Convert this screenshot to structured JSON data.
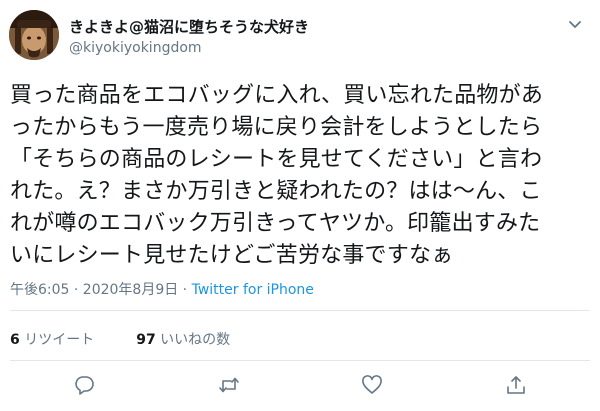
{
  "user": {
    "display_name": "きよきよ@猫沼に堕ちそうな犬好き",
    "handle": "@kiyokiyokingdom"
  },
  "tweet": {
    "lines": [
      "買った商品をエコバッグに入れ、買い忘れた品物があ",
      "ったからもう一度売り場に戻り会計をしようとしたら",
      "「そちらの商品のレシートを見せてください」と言わ",
      "れた。え？まさか万引きと疑われたの？はは〜ん、こ",
      "れが噂のエコバック万引きってヤツか。印籠出すみた",
      "いにレシート見せたけどご苦労な事ですなぁ"
    ],
    "timestamp": "午後6:05 · 2020年8月9日 · ",
    "source": "Twitter for iPhone"
  },
  "stats": {
    "retweets_count": "6",
    "retweets_label": "リツイート",
    "likes_count": "97",
    "likes_label": "いいねの数"
  },
  "icons": {
    "menu": "chevron-down-icon",
    "reply": "reply-icon",
    "retweet": "retweet-icon",
    "like": "heart-icon",
    "share": "share-icon"
  },
  "colors": {
    "text": "#14171a",
    "secondary": "#657786",
    "link": "#1b95e0",
    "divider": "#e1e8ed"
  }
}
